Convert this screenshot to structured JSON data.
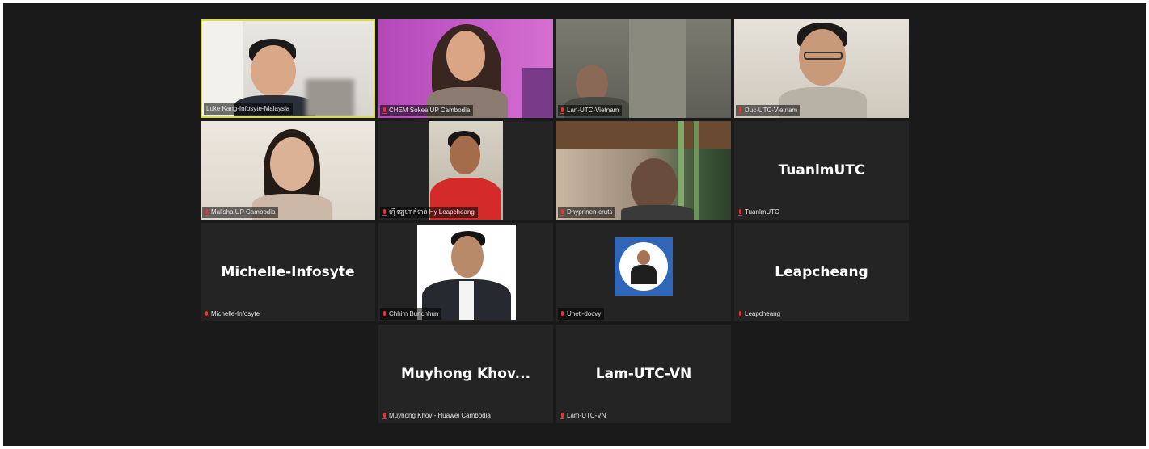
{
  "participants": [
    {
      "tile_name": "Luke Kang-Infosyte-Malaysia",
      "big_name": "",
      "active_speaker": true,
      "muted": false
    },
    {
      "tile_name": "CHEM Sokea UP Cambodia",
      "big_name": "",
      "muted": true
    },
    {
      "tile_name": "Lan-UTC-Vietnam",
      "big_name": "",
      "muted": true
    },
    {
      "tile_name": "Duc-UTC-Vietnam",
      "big_name": "",
      "muted": true
    },
    {
      "tile_name": "Malisha UP Cambodia",
      "big_name": "",
      "muted": true
    },
    {
      "tile_name": "ហ៊ី ឡេហាក់ទាន់ Hy Leapcheang",
      "big_name": "",
      "muted": true
    },
    {
      "tile_name": "Dhyprinen-cruts",
      "big_name": "",
      "muted": true
    },
    {
      "tile_name": "TuanlmUTC",
      "big_name": "TuanlmUTC",
      "muted": true
    },
    {
      "tile_name": "Michelle-Infosyte",
      "big_name": "Michelle-Infosyte",
      "muted": true
    },
    {
      "tile_name": "Chhim Bunchhun",
      "big_name": "",
      "muted": true
    },
    {
      "tile_name": "Uneti-docvy",
      "big_name": "",
      "muted": true
    },
    {
      "tile_name": "Leapcheang",
      "big_name": "Leapcheang",
      "muted": true
    },
    {
      "tile_name": "Muyhong Khov - Huawei Cambodia",
      "big_name": "Muyhong  Khov...",
      "muted": true
    },
    {
      "tile_name": "Lam-UTC-VN",
      "big_name": "Lam-UTC-VN",
      "muted": true
    }
  ],
  "colors": {
    "background": "#1a1a1a",
    "tile": "#242424",
    "active_speaker_border": "#d9dc4b",
    "muted_mic": "#e03636"
  }
}
